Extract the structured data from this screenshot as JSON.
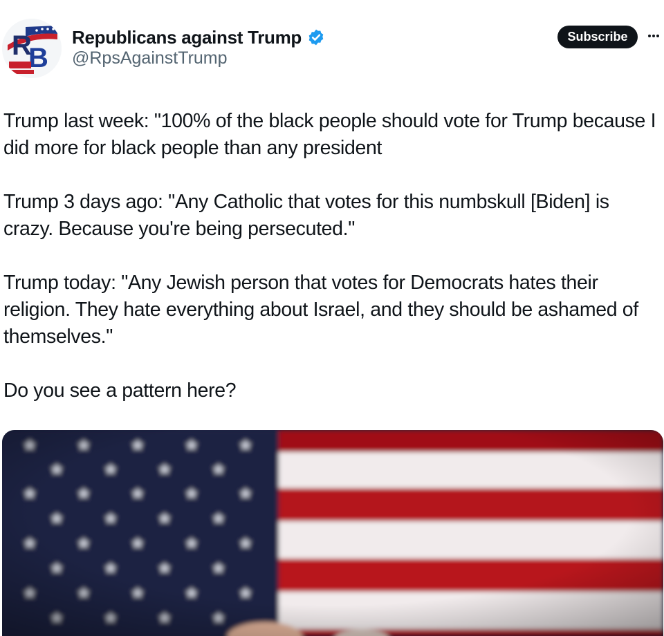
{
  "author": {
    "display_name": "Republicans against Trump",
    "handle": "@RpsAgainstTrump",
    "avatar_monogram": "RB",
    "verified": true,
    "verified_color": "#1d9bf0"
  },
  "actions": {
    "subscribe_label": "Subscribe",
    "more_icon": "more-horizontal-icon"
  },
  "tweet": {
    "paragraphs": [
      "Trump last week: \"100% of the black people should vote for Trump because I did more for black people than any president",
      "Trump 3 days ago: \"Any Catholic that votes for this numbskull [Biden] is crazy. Because you're being persecuted.\"",
      "Trump today: \"Any Jewish person that votes for Democrats hates their religion. They hate everything about Israel, and they should be ashamed of themselves.\"",
      "Do you see a pattern here?"
    ]
  },
  "media": {
    "type": "photo",
    "subject": "american-flag"
  },
  "colors": {
    "text": "#0f1419",
    "secondary_text": "#536471",
    "button_bg": "#0f1419",
    "flag_blue": "#1b2442",
    "flag_red": "#b0131c",
    "flag_white": "#efe9ea"
  }
}
